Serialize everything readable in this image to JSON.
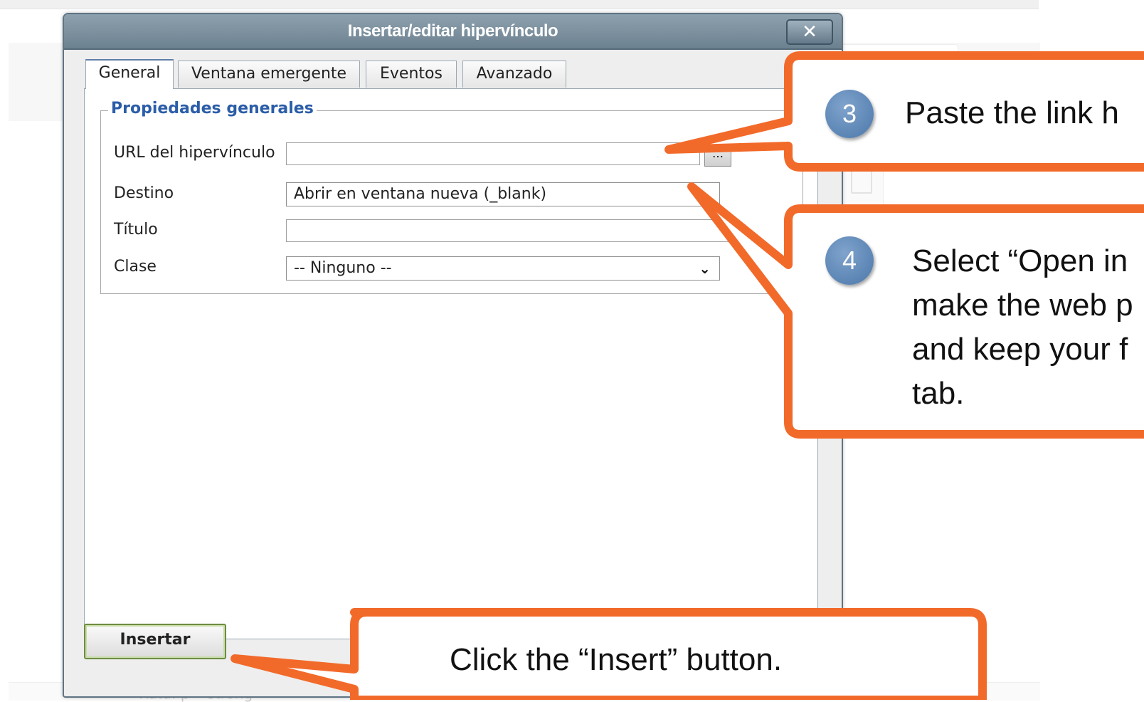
{
  "dialog": {
    "title": "Insertar/editar hipervínculo",
    "close_label": "✕",
    "tabs": [
      {
        "label": "General"
      },
      {
        "label": "Ventana emergente"
      },
      {
        "label": "Eventos"
      },
      {
        "label": "Avanzado"
      }
    ],
    "legend": "Propiedades generales",
    "fields": {
      "url_label": "URL del hipervínculo",
      "url_value": "",
      "target_label": "Destino",
      "target_value": "Abrir en ventana nueva (_blank)",
      "title_label": "Título",
      "title_value": "",
      "class_label": "Clase",
      "class_value": "-- Ninguno --"
    },
    "insert_label": "Insertar"
  },
  "background": {
    "status_text": "Ruta: p » strong"
  },
  "callouts": {
    "step3": {
      "number": "3",
      "text": "Paste the link h"
    },
    "step4": {
      "number": "4",
      "lines": [
        "Select “Open in",
        "make the web p",
        "and keep your f",
        "tab."
      ]
    },
    "insert": {
      "text": "Click the “Insert” button."
    }
  },
  "colors": {
    "callout_orange": "#f26a2a",
    "title_bar": "#7d909d",
    "legend_blue": "#2b5da8",
    "step_circle": "#5b83b3"
  }
}
